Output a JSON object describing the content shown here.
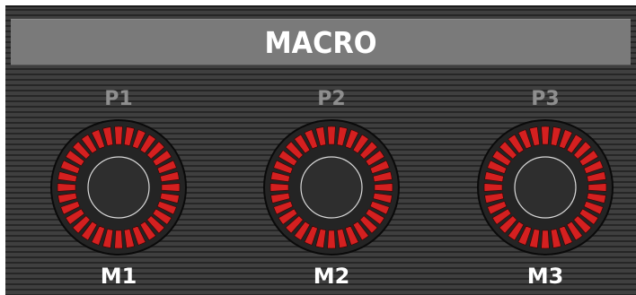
{
  "header": {
    "title": "MACRO"
  },
  "macros": [
    {
      "param_label": "P1",
      "macro_label": "M1"
    },
    {
      "param_label": "P2",
      "macro_label": "M2"
    },
    {
      "param_label": "P3",
      "macro_label": "M3"
    }
  ],
  "colors": {
    "panel_bg": "#3a3a3a",
    "header_bg": "#7a7a7a",
    "segment_active": "#d42020",
    "param_label": "#8e8e8e",
    "macro_label": "#ffffff"
  },
  "icons": {
    "knob": "rotary-knob-icon"
  }
}
